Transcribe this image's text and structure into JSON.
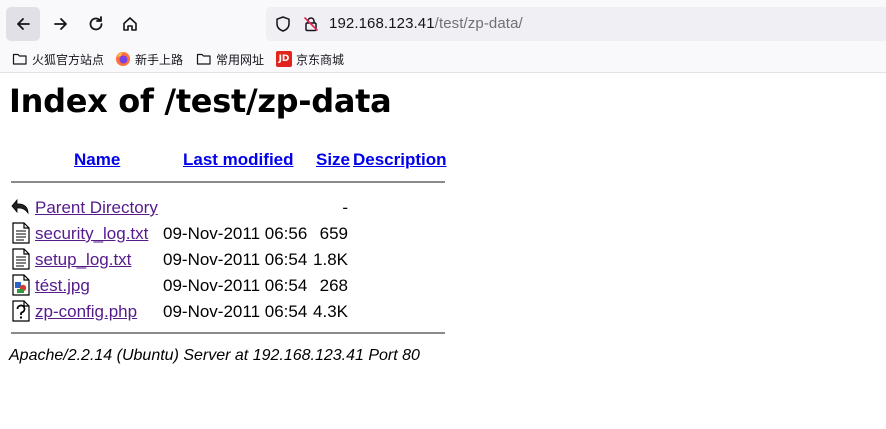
{
  "browser": {
    "url_host": "192.168.123.41",
    "url_path": "/test/zp-data/"
  },
  "bookmarks": [
    {
      "label": "火狐官方站点",
      "icon": "folder-icon"
    },
    {
      "label": "新手上路",
      "icon": "firefox-icon"
    },
    {
      "label": "常用网址",
      "icon": "folder-icon"
    },
    {
      "label": "京东商城",
      "icon": "jd-icon",
      "icon_text": "JD"
    }
  ],
  "page": {
    "title": "Index of /test/zp-data",
    "columns": {
      "name": "Name",
      "last_modified": "Last modified",
      "size": "Size",
      "description": "Description"
    },
    "rows": [
      {
        "name": "Parent Directory",
        "date": "",
        "size": "-",
        "icon": "back-arrow-icon"
      },
      {
        "name": "security_log.txt",
        "date": "09-Nov-2011 06:56",
        "size": "659",
        "icon": "text-file-icon"
      },
      {
        "name": "setup_log.txt",
        "date": "09-Nov-2011 06:54",
        "size": "1.8K",
        "icon": "text-file-icon"
      },
      {
        "name": "tést.jpg",
        "date": "09-Nov-2011 06:54",
        "size": "268",
        "icon": "image-file-icon"
      },
      {
        "name": "zp-config.php",
        "date": "09-Nov-2011 06:54",
        "size": "4.3K",
        "icon": "unknown-file-icon"
      }
    ],
    "address": "Apache/2.2.14 (Ubuntu) Server at 192.168.123.41 Port 80"
  },
  "colors": {
    "link": "#0000ee",
    "visited_link": "#551a8b",
    "jd_brand": "#e1251b"
  }
}
